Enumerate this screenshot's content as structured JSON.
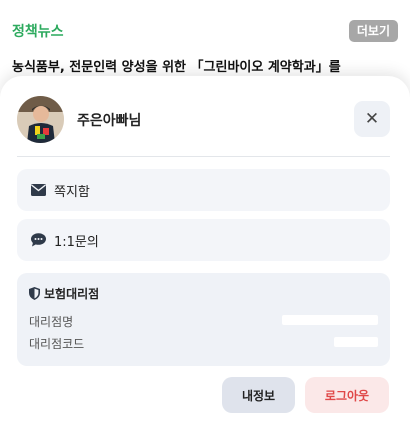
{
  "background": {
    "section_title": "정책뉴스",
    "more_button": "더보기",
    "headline": "농식품부, 전문인력 양성을 위한 「그린바이오 계약학과」를"
  },
  "profile": {
    "name": "주은아빠님"
  },
  "menu": {
    "message_box": "쪽지함",
    "inquiry": "1:1문의"
  },
  "agency": {
    "title": "보험대리점",
    "name_label": "대리점명",
    "code_label": "대리점코드"
  },
  "buttons": {
    "my_info": "내정보",
    "logout": "로그아웃"
  },
  "colors": {
    "accent_green": "#2daa5e",
    "logout_text": "#e04848"
  }
}
